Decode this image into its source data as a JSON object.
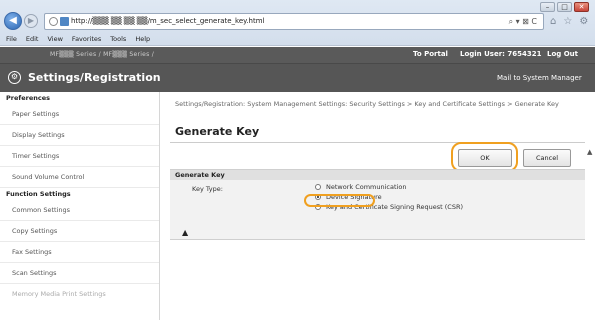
{
  "browser": {
    "url": "http://▒▒▒ ▒▒ ▒▒ ▒▒/m_sec_select_generate_key.html",
    "address_tools": "⌕ ▾ ⊠ C",
    "menu": [
      "File",
      "Edit",
      "View",
      "Favorites",
      "Tools",
      "Help"
    ]
  },
  "header": {
    "device_name": "MF▒▒▒ Series / MF▒▒▒ Series /",
    "to_portal": "To Portal",
    "login_user": "Login User:  7654321",
    "logout": "Log Out",
    "app_title": "Settings/Registration",
    "mail_link": "Mail to System Manager"
  },
  "sidebar": {
    "preferences_heading": "Preferences",
    "preferences": [
      "Paper Settings",
      "Display Settings",
      "Timer Settings",
      "Sound Volume Control"
    ],
    "function_heading": "Function Settings",
    "function": [
      "Common Settings",
      "Copy Settings",
      "Fax Settings",
      "Scan Settings",
      "Memory Media Print Settings"
    ]
  },
  "main": {
    "breadcrumb": "Settings/Registration: System Management Settings: Security Settings > Key and Certificate Settings > Generate Key",
    "title": "Generate Key",
    "ok_label": "OK",
    "cancel_label": "Cancel",
    "section_title": "Generate Key",
    "key_type_label": "Key Type:",
    "options": [
      "Network Communication",
      "Device Signature",
      "Key and Certificate Signing Request (CSR)"
    ],
    "selected_option": "Device Signature",
    "top_anchor": "▲"
  },
  "colors": {
    "header_bg": "#565656",
    "highlight": "#f0a020"
  }
}
